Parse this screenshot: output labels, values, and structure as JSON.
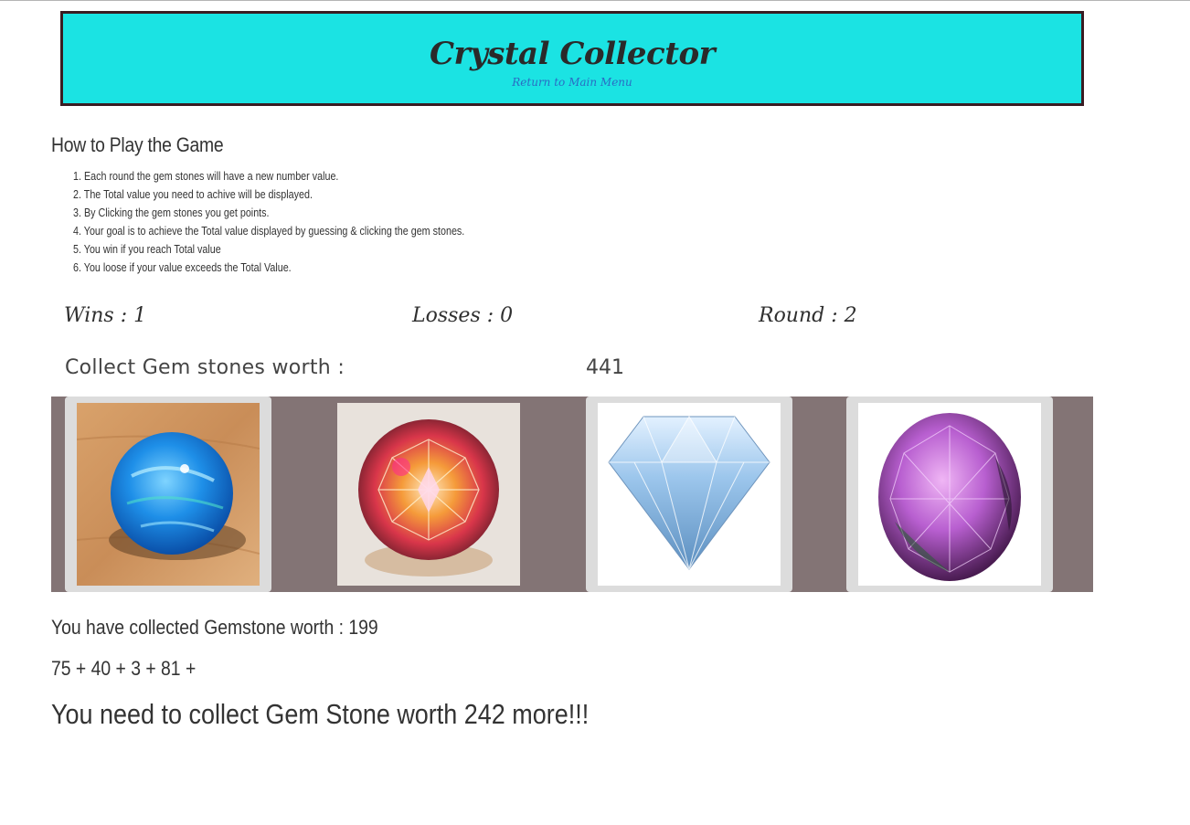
{
  "header": {
    "title": "Crystal Collector",
    "menu_link": "Return to Main Menu"
  },
  "instructions": {
    "heading": "How to Play the Game",
    "rules": [
      "1. Each round the gem stones will have a new number value.",
      "2. The Total value you need to achive will be displayed.",
      "3. By Clicking the gem stones you get points.",
      "4. Your goal is to achieve the Total value displayed by guessing & clicking the gem stones.",
      "5. You win if you reach Total value",
      "6. You loose if your value exceeds the Total Value."
    ]
  },
  "stats": {
    "wins": "Wins : 1",
    "losses": "Losses : 0",
    "round": "Round : 2"
  },
  "goal": {
    "label": "Collect Gem stones worth :",
    "target": "441"
  },
  "gems": [
    {
      "name": "blue-opal-gem-icon"
    },
    {
      "name": "mystic-topaz-gem-icon"
    },
    {
      "name": "diamond-gem-icon"
    },
    {
      "name": "amethyst-gem-icon"
    }
  ],
  "progress": {
    "collected_text": "You have collected Gemstone worth : 199",
    "sequence": "75 + 40 + 3 + 81 +",
    "remaining_text": "You need to collect Gem Stone worth 242 more!!!"
  },
  "colors": {
    "header_bg": "#1be3e3",
    "header_border": "#3a1c22",
    "gem_strip_bg": "#837475",
    "link": "#2a6cc4"
  }
}
